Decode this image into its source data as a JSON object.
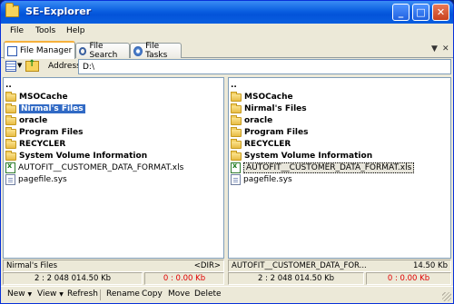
{
  "window": {
    "title": "SE-Explorer"
  },
  "menu": [
    "File",
    "Tools",
    "Help"
  ],
  "tabs": [
    {
      "label": "File Manager",
      "icon": "file-manager-icon",
      "active": true
    },
    {
      "label": "File Search",
      "icon": "search-icon"
    },
    {
      "label": "File Tasks",
      "icon": "tasks-icon"
    }
  ],
  "address": {
    "label": "Address",
    "value": "D:\\"
  },
  "left_pane": {
    "items": [
      {
        "name": "..",
        "type": "up"
      },
      {
        "name": "MSOCache",
        "type": "dir"
      },
      {
        "name": "Nirmal's Files",
        "type": "dir",
        "selected": true
      },
      {
        "name": "oracle",
        "type": "dir"
      },
      {
        "name": "Program Files",
        "type": "dir"
      },
      {
        "name": "RECYCLER",
        "type": "dir"
      },
      {
        "name": "System Volume Information",
        "type": "dir"
      },
      {
        "name": "AUTOFIT__CUSTOMER_DATA_FORMAT.xls",
        "type": "xls"
      },
      {
        "name": "pagefile.sys",
        "type": "sys"
      }
    ],
    "status_name": "Nirmal's Files",
    "status_size": "<DIR>",
    "summary": "2 : 2 048 014.50 Kb",
    "selection": "0 : 0.00 Kb"
  },
  "right_pane": {
    "items": [
      {
        "name": "..",
        "type": "up"
      },
      {
        "name": "MSOCache",
        "type": "dir"
      },
      {
        "name": "Nirmal's Files",
        "type": "dir"
      },
      {
        "name": "oracle",
        "type": "dir"
      },
      {
        "name": "Program Files",
        "type": "dir"
      },
      {
        "name": "RECYCLER",
        "type": "dir"
      },
      {
        "name": "System Volume Information",
        "type": "dir"
      },
      {
        "name": "AUTOFIT__CUSTOMER_DATA_FORMAT.xls",
        "type": "xls",
        "focused": true
      },
      {
        "name": "pagefile.sys",
        "type": "sys"
      }
    ],
    "status_name": "AUTOFIT__CUSTOMER_DATA_FOR...",
    "status_size": "14.50 Kb",
    "summary": "2 : 2 048 014.50 Kb",
    "selection": "0 : 0.00 Kb"
  },
  "bottom_toolbar": [
    "New",
    "View",
    "Refresh",
    "Rename",
    "Copy",
    "Move",
    "Delete"
  ]
}
